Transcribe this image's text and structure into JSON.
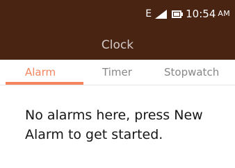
{
  "status_bar": {
    "network_type": "E",
    "signal_icon": "signal-bars-icon",
    "battery_icon": "battery-icon",
    "time": "10:54",
    "ampm": "AM"
  },
  "app": {
    "title": "Clock"
  },
  "tabs": [
    {
      "label": "Alarm",
      "selected": true
    },
    {
      "label": "Timer",
      "selected": false
    },
    {
      "label": "Stopwatch",
      "selected": false
    }
  ],
  "alarm_list": {
    "empty_message": "No alarms here, press New Alarm to get started."
  },
  "colors": {
    "header_bg": "#4a2413",
    "accent": "#f2855f",
    "tab_inactive": "#878787",
    "title_text": "#d3cac6"
  }
}
